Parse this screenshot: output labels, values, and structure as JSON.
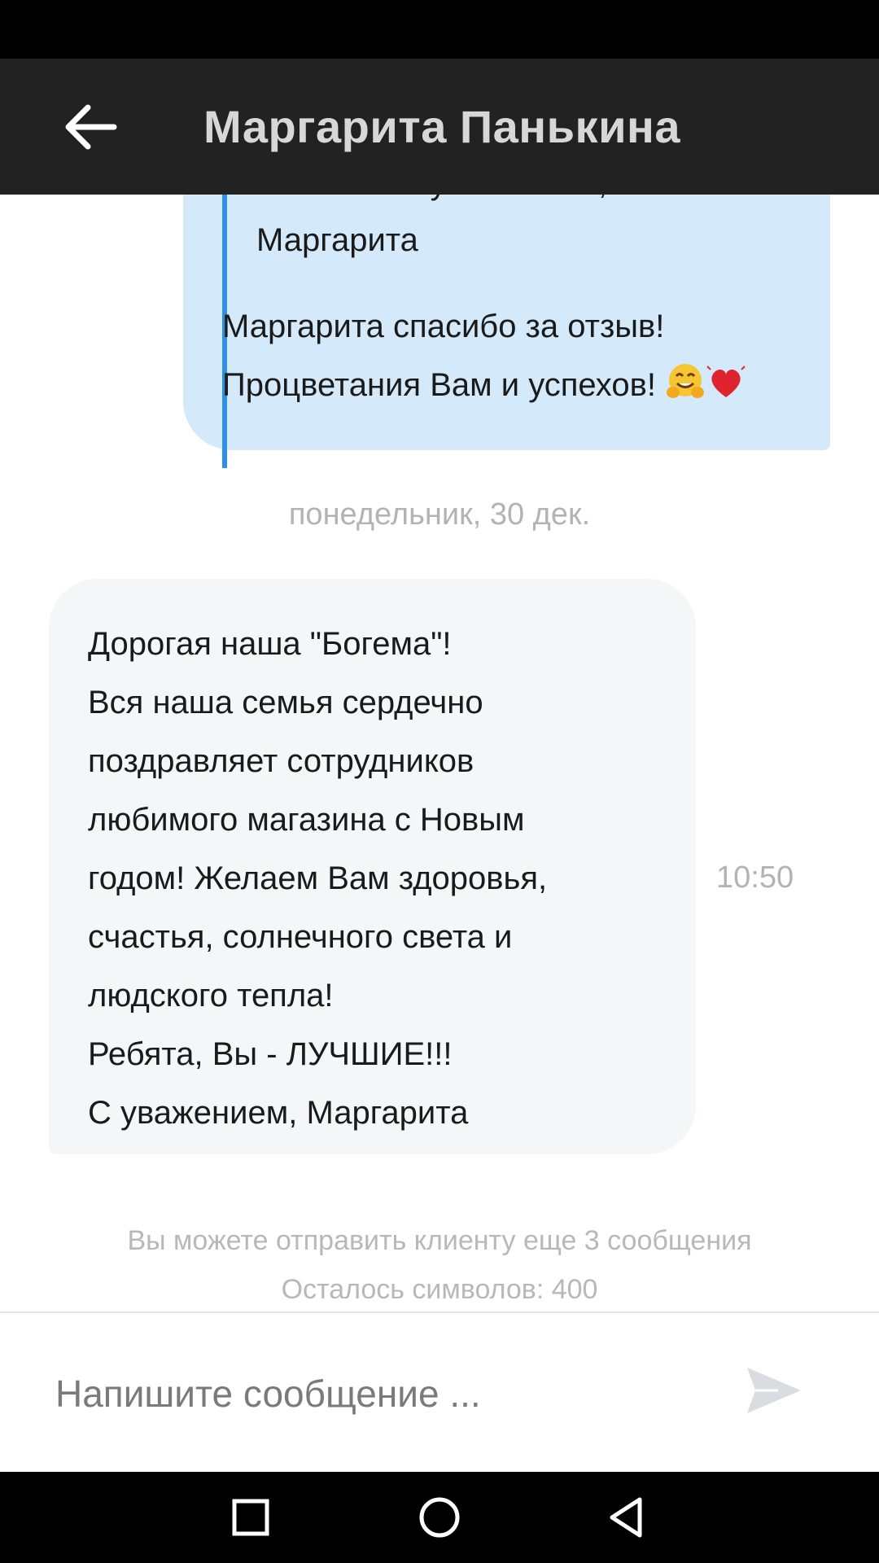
{
  "header": {
    "title": "Маргарита Панькина",
    "back_icon": "arrow-left-icon"
  },
  "outgoing_message": {
    "quote_partial_line": "спасибо! С уважением,",
    "quote_signature": "Маргарита",
    "lines": [
      "Маргарита спасибо за отзыв!",
      "Процветания Вам и успехов!"
    ],
    "emojis": [
      "hugging-face-emoji",
      "heart-emoji"
    ]
  },
  "date_separator": "понедельник, 30 дек.",
  "incoming_message": {
    "lines": [
      "Дорогая наша \"Богема\"!",
      "Вся наша семья сердечно",
      "поздравляет сотрудников",
      "любимого магазина с Новым",
      "годом! Желаем Вам здоровья,",
      "счастья, солнечного света и",
      "людского тепла!",
      "Ребята, Вы - ЛУЧШИЕ!!!",
      "С уважением, Маргарита"
    ],
    "time": "10:50"
  },
  "limits": {
    "messages_left": "Вы можете отправить клиенту еще 3 сообщения",
    "chars_left": "Осталось символов: 400"
  },
  "composer": {
    "placeholder": "Напишите сообщение ...",
    "value": "",
    "send_icon": "send-icon"
  },
  "nav": [
    "square-recents-icon",
    "circle-home-icon",
    "triangle-back-icon"
  ],
  "colors": {
    "app_bar": "#222222",
    "outgoing_bubble": "#d4eafb",
    "incoming_bubble": "#f5f6f8",
    "quote_bar": "#2d8fe6",
    "muted_text": "#b3b3b3"
  }
}
